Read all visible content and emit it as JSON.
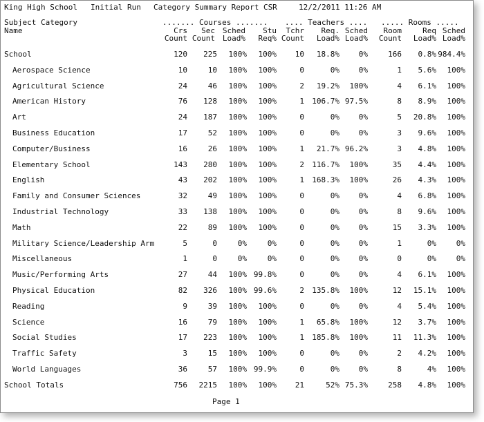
{
  "header": {
    "school": "King High School",
    "run": "Initial Run",
    "report": "Category Summary Report CSR",
    "date": "12/2/2011 11:26 AM"
  },
  "columns": {
    "subject_category": "Subject Category",
    "name": "Name",
    "courses_group": "....... Courses .......",
    "teachers_group": ".... Teachers ....",
    "rooms_group": "..... Rooms .....",
    "crs1": "Crs",
    "crs2": "Count",
    "sec1": "Sec",
    "sec2": "Count",
    "sched1": "Sched",
    "sched2": "Load%",
    "stu1": "Stu",
    "stu2": "Req%",
    "tchr1": "Tchr",
    "tchr2": "Count",
    "treq1": "Req.",
    "treq2": "Load%",
    "tsched1": "Sched",
    "tsched2": "Load%",
    "room1": "Room",
    "room2": "Count",
    "rreq1": "Req",
    "rreq2": "Load%",
    "rsched1": "Sched",
    "rsched2": "Load%"
  },
  "rows": [
    [
      "School",
      "120",
      "225",
      "100%",
      "100%",
      "10",
      "18.8%",
      "0%",
      "166",
      "0.8%",
      "984.4%"
    ],
    [
      "Aerospace Science",
      "10",
      "10",
      "100%",
      "100%",
      "0",
      "0%",
      "0%",
      "1",
      "5.6%",
      "100%"
    ],
    [
      "Agricultural Science",
      "24",
      "46",
      "100%",
      "100%",
      "2",
      "19.2%",
      "100%",
      "4",
      "6.1%",
      "100%"
    ],
    [
      "American History",
      "76",
      "128",
      "100%",
      "100%",
      "1",
      "106.7%",
      "97.5%",
      "8",
      "8.9%",
      "100%"
    ],
    [
      "Art",
      "24",
      "187",
      "100%",
      "100%",
      "0",
      "0%",
      "0%",
      "5",
      "20.8%",
      "100%"
    ],
    [
      "Business Education",
      "17",
      "52",
      "100%",
      "100%",
      "0",
      "0%",
      "0%",
      "3",
      "9.6%",
      "100%"
    ],
    [
      "Computer/Business",
      "16",
      "26",
      "100%",
      "100%",
      "1",
      "21.7%",
      "96.2%",
      "3",
      "4.8%",
      "100%"
    ],
    [
      "Elementary School",
      "143",
      "280",
      "100%",
      "100%",
      "2",
      "116.7%",
      "100%",
      "35",
      "4.4%",
      "100%"
    ],
    [
      "English",
      "43",
      "202",
      "100%",
      "100%",
      "1",
      "168.3%",
      "100%",
      "26",
      "4.3%",
      "100%"
    ],
    [
      "Family and Consumer Sciences",
      "32",
      "49",
      "100%",
      "100%",
      "0",
      "0%",
      "0%",
      "4",
      "6.8%",
      "100%"
    ],
    [
      "Industrial Technology",
      "33",
      "138",
      "100%",
      "100%",
      "0",
      "0%",
      "0%",
      "8",
      "9.6%",
      "100%"
    ],
    [
      "Math",
      "22",
      "89",
      "100%",
      "100%",
      "0",
      "0%",
      "0%",
      "15",
      "3.3%",
      "100%"
    ],
    [
      "Military Science/Leadership Arm",
      "5",
      "0",
      "0%",
      "0%",
      "0",
      "0%",
      "0%",
      "1",
      "0%",
      "0%"
    ],
    [
      "Miscellaneous",
      "1",
      "0",
      "0%",
      "0%",
      "0",
      "0%",
      "0%",
      "0",
      "0%",
      "0%"
    ],
    [
      "Music/Performing Arts",
      "27",
      "44",
      "100%",
      "99.8%",
      "0",
      "0%",
      "0%",
      "4",
      "6.1%",
      "100%"
    ],
    [
      "Physical Education",
      "82",
      "326",
      "100%",
      "99.6%",
      "2",
      "135.8%",
      "100%",
      "12",
      "15.1%",
      "100%"
    ],
    [
      "Reading",
      "9",
      "39",
      "100%",
      "100%",
      "0",
      "0%",
      "0%",
      "4",
      "5.4%",
      "100%"
    ],
    [
      "Science",
      "16",
      "79",
      "100%",
      "100%",
      "1",
      "65.8%",
      "100%",
      "12",
      "3.7%",
      "100%"
    ],
    [
      "Social Studies",
      "17",
      "223",
      "100%",
      "100%",
      "1",
      "185.8%",
      "100%",
      "11",
      "11.3%",
      "100%"
    ],
    [
      "Traffic Safety",
      "3",
      "15",
      "100%",
      "100%",
      "0",
      "0%",
      "0%",
      "2",
      "4.2%",
      "100%"
    ],
    [
      "World Languages",
      "36",
      "57",
      "100%",
      "99.9%",
      "0",
      "0%",
      "0%",
      "8",
      "4%",
      "100%"
    ],
    [
      "School Totals",
      "756",
      "2215",
      "100%",
      "100%",
      "21",
      "52%",
      "75.3%",
      "258",
      "4.8%",
      "100%"
    ]
  ],
  "footer": {
    "page": "Page 1"
  }
}
